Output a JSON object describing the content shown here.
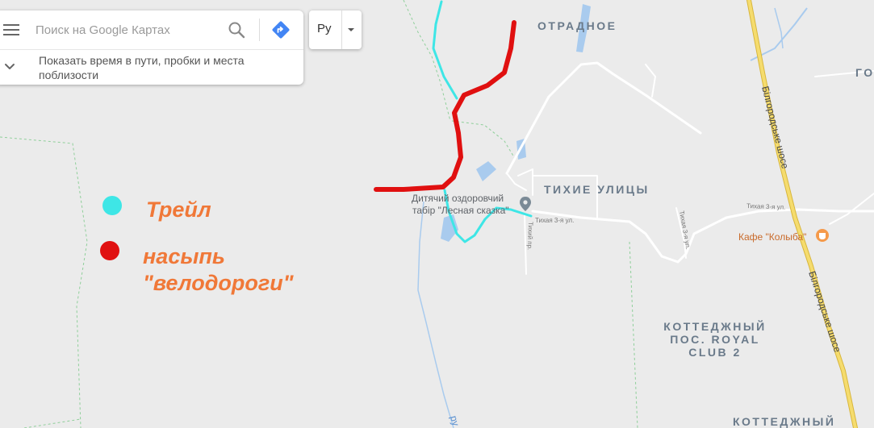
{
  "search": {
    "placeholder": "Поиск на Google Картах"
  },
  "info_row": {
    "text": "Показать время в пути, пробки и места поблизости"
  },
  "language": {
    "label": "Ру"
  },
  "places": {
    "otradnoe": "ОТРАДНОЕ",
    "tikhie_ulitsy": "ТИХИЕ УЛИЦЫ",
    "camp_line1": "Дитячий оздоровчий",
    "camp_line2": "табір \"Лесная сказка\"",
    "cafe": "Кафе \"Колыба\"",
    "cottage_line1": "КОТТЕДЖНЫЙ",
    "cottage_line2": "ПОС. ROYAL",
    "cottage_line3": "CLUB 2",
    "cottage_bottom": "КОТТЕДЖНЫЙ",
    "go_partial": "ГО",
    "highway1": "Білгородське шосе",
    "highway2": "Білгородське шосе",
    "street1": "Тихая 3-я ул.",
    "street2": "Тихая 3-я ул.",
    "street3": "Тихая 3-я ул.",
    "street4": "Тихий пр.",
    "river_partial": "ру"
  },
  "legend": {
    "trail_label": "Трейл",
    "embankment_label_line1": "насыпь",
    "embankment_label_line2": "\"велодороги\""
  },
  "colors": {
    "map_background": "#ebebeb",
    "road": "#ffffff",
    "highway": "#f2d45c",
    "water": "#a9cbee",
    "park_border": "#8fcf9a",
    "trail": "#3ee6e6",
    "embankment": "#e01010",
    "legend_text": "#f07838",
    "place_label": "#6a7a8a",
    "poi": "#f59a4a"
  }
}
